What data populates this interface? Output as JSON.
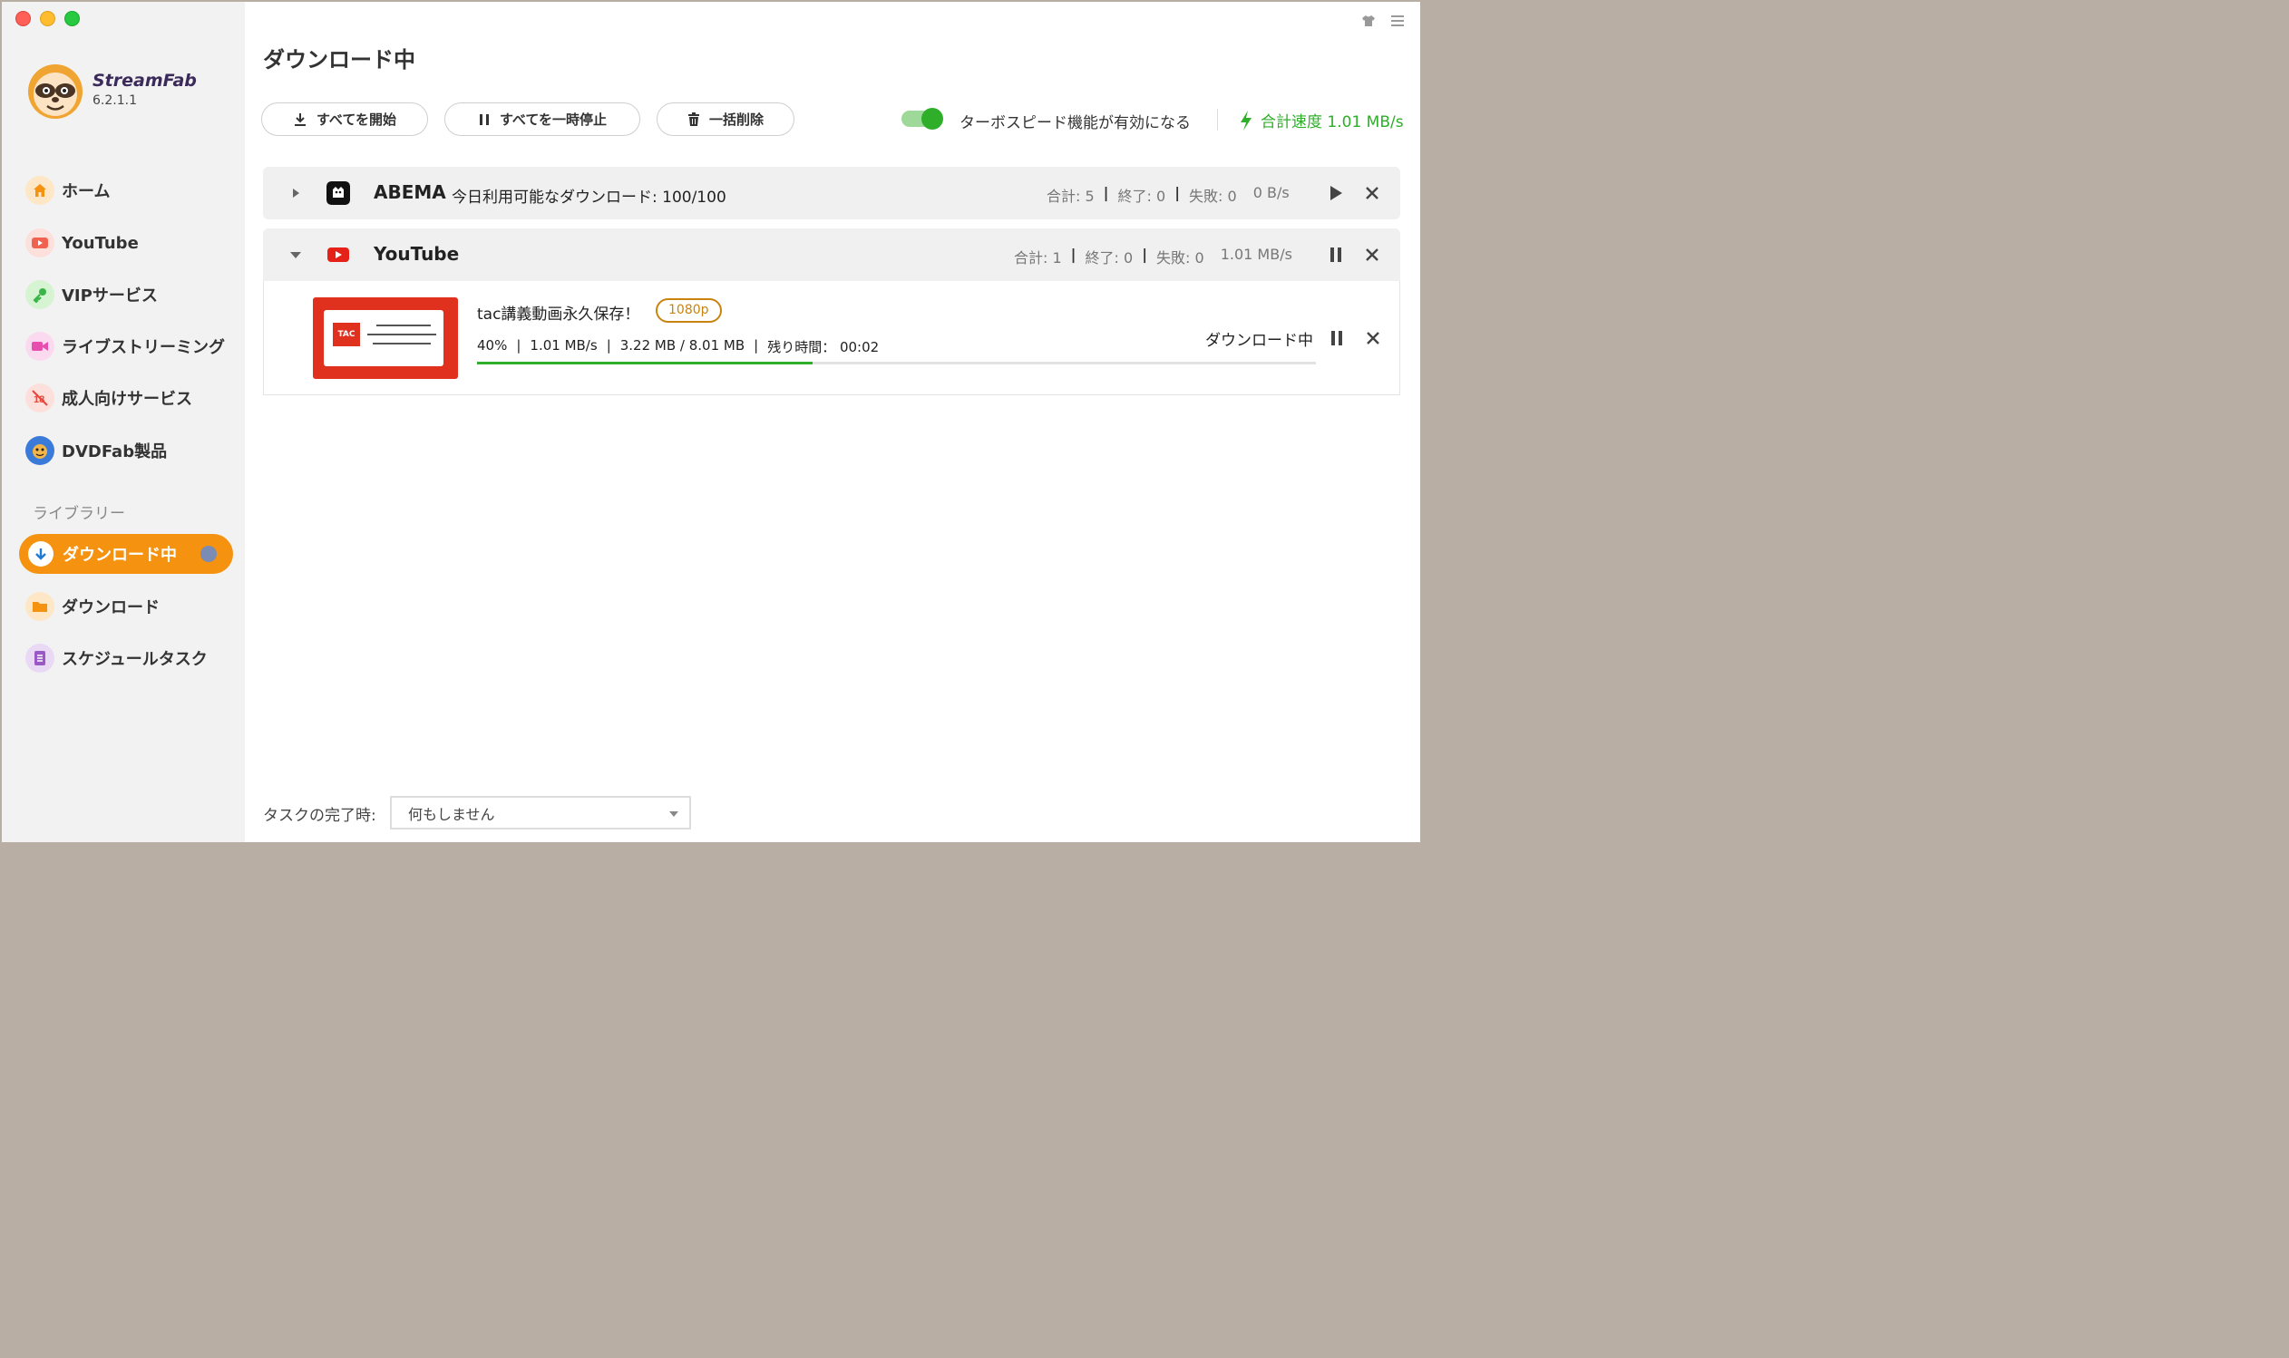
{
  "app": {
    "brand": "StreamFab",
    "version": "6.2.1.1"
  },
  "sidebar": {
    "items": [
      {
        "label": "ホーム",
        "icon": "home-icon"
      },
      {
        "label": "YouTube",
        "icon": "youtube-icon"
      },
      {
        "label": "VIPサービス",
        "icon": "key-icon"
      },
      {
        "label": "ライブストリーミング",
        "icon": "video-camera-icon"
      },
      {
        "label": "成人向けサービス",
        "icon": "adult-18-icon"
      },
      {
        "label": "DVDFab製品",
        "icon": "dvdfab-logo-icon"
      }
    ],
    "library_label": "ライブラリー",
    "library_items": [
      {
        "label": "ダウンロード中",
        "icon": "download-arrow-icon",
        "active": true
      },
      {
        "label": "ダウンロード",
        "icon": "folder-icon"
      },
      {
        "label": "スケジュールタスク",
        "icon": "schedule-list-icon"
      }
    ]
  },
  "main": {
    "title": "ダウンロード中",
    "toolbar": {
      "start_all": "すべてを開始",
      "pause_all": "すべてを一時停止",
      "delete_all": "一括削除"
    },
    "turbo": {
      "label": "ターボスピード機能が有効になる",
      "enabled": true
    },
    "total_speed": "合計速度 1.01 MB/s",
    "groups": [
      {
        "name": "ABEMA",
        "note": "今日利用可能なダウンロード: 100/100",
        "total": "合計: 5",
        "done": "終了: 0",
        "failed": "失敗: 0",
        "speed": "0 B/s",
        "expanded": false
      },
      {
        "name": "YouTube",
        "note": "",
        "total": "合計: 1",
        "done": "終了: 0",
        "failed": "失敗: 0",
        "speed": "1.01 MB/s",
        "expanded": true
      }
    ],
    "task": {
      "title": "tac講義動画永久保存！",
      "quality": "1080p",
      "percent": "40%",
      "progress": 0.4,
      "speed": "1.01 MB/s",
      "size": "3.22 MB / 8.01 MB",
      "remaining": "残り時間： 00:02",
      "status": "ダウンロード中",
      "thumb_badge": "TAC"
    },
    "footer": {
      "label": "タスクの完了時:",
      "select_value": "何もしません"
    }
  },
  "colors": {
    "accent": "#f5920f",
    "green": "#2fae2a",
    "quality": "#c9830f",
    "youtube_red": "#e0301e"
  }
}
